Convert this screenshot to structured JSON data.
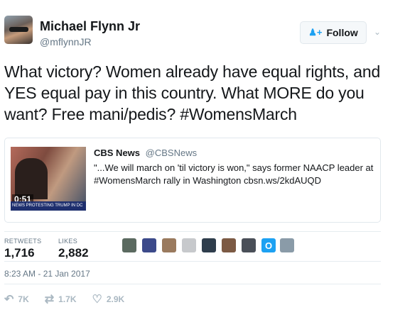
{
  "header": {
    "display_name": "Michael Flynn Jr",
    "handle": "@mflynnJR",
    "follow_label": "Follow",
    "follow_icon": "add-user-icon",
    "caret_icon": "chevron-down-icon"
  },
  "tweet": {
    "text": "What victory? Women already have equal rights, and YES equal pay in this country. What MORE do you want? Free mani/pedis? #WomensMarch"
  },
  "card": {
    "source_name": "CBS News",
    "source_handle": "@CBSNews",
    "body": "\"...We will march on 'til victory is won,\" says former NAACP leader at #WomensMarch rally in Washington cbsn.ws/2kdAUQD",
    "video_duration": "0:51",
    "banner_text": "NEWS PROTESTING TRUMP IN DC"
  },
  "stats": {
    "retweets_label": "RETWEETS",
    "retweets_value": "1,716",
    "likes_label": "LIKES",
    "likes_value": "2,882"
  },
  "likers": {
    "colors": [
      "#5b6a60",
      "#3c4a8a",
      "#9a7a5e",
      "#c7c9cc",
      "#2f3d4c",
      "#7c5a44",
      "#4a4f58",
      "#1da1f2",
      "#8a9ba8"
    ],
    "o_avatar_glyph": "O"
  },
  "timestamp": "8:23 AM - 21 Jan 2017",
  "actions": {
    "reply_icon": "reply-icon",
    "reply_count": "7K",
    "retweet_icon": "retweet-icon",
    "retweet_count": "1.7K",
    "like_icon": "heart-icon",
    "like_count": "2.9K"
  },
  "colors": {
    "accent": "#1da1f2",
    "text": "#14171a",
    "muted": "#657786"
  }
}
